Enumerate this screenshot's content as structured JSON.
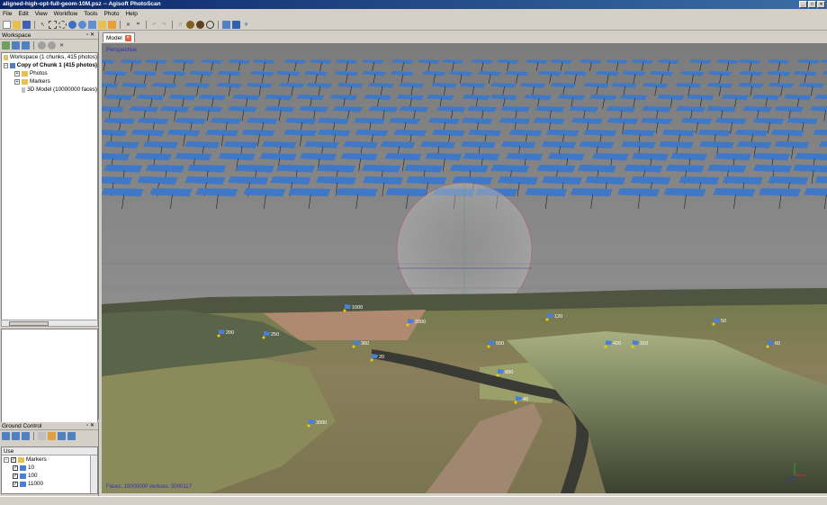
{
  "window": {
    "title": "aligned-high-opt-full-geom-10M.psz -- Agisoft PhotoScan",
    "controls": [
      "minimize-icon",
      "maximize-icon",
      "close-icon"
    ]
  },
  "menu": [
    "File",
    "Edit",
    "View",
    "Workflow",
    "Tools",
    "Photo",
    "Help"
  ],
  "toolbar": {
    "icons": [
      "new-icon",
      "open-icon",
      "save-icon",
      "select-icon",
      "rect-select-icon",
      "circle-select-icon",
      "navigation-icon",
      "rotate-icon",
      "region-icon",
      "resize-region-icon",
      "rotate-region-icon",
      "delete-icon",
      "crop-icon",
      "undo-icon",
      "redo-icon",
      "point-cloud-icon",
      "solid-icon",
      "textured-icon",
      "wireframe-icon",
      "cameras-icon",
      "markers-icon",
      "reset-view-icon"
    ]
  },
  "workspace": {
    "header": "Workspace",
    "tree": {
      "root": "Workspace (1 chunks, 415 photos)",
      "chunk": "Copy of Chunk 1 (415 photos)",
      "photos": "Photos",
      "markers": "Markers",
      "model": "3D Model (10000000 faces)"
    }
  },
  "ground_control": {
    "header": "Ground Control",
    "column_use": "Use",
    "rows": [
      "Markers",
      "10",
      "100",
      "11000"
    ]
  },
  "model": {
    "tab_label": "Model",
    "perspective_label": "Perspective",
    "stats_label": "Faces: 10000000 vertices: 5000117",
    "marker_labels": [
      "1000",
      "2000",
      "200",
      "250",
      "360",
      "50",
      "60",
      "20",
      "420",
      "500",
      "120",
      "310",
      "890",
      "3000",
      "40"
    ],
    "colors": {
      "sky": "#8e8e8e",
      "camera_plane": "#3f78c7",
      "marker_flag": "#4a7fd8",
      "label_text": "#3030c0"
    }
  }
}
